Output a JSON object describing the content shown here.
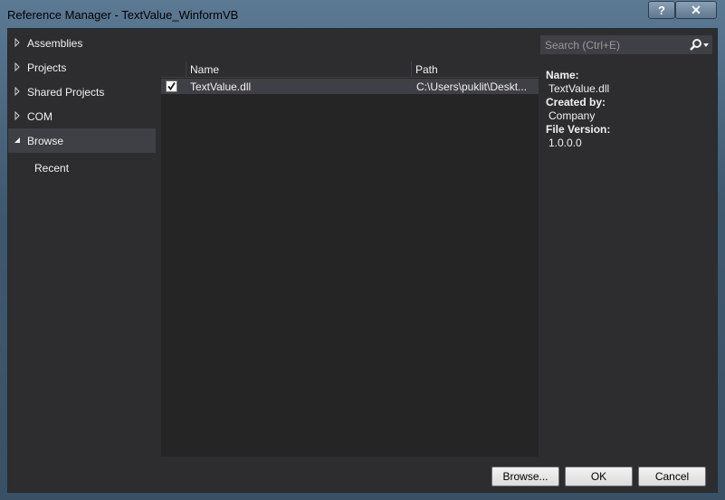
{
  "window": {
    "title": "Reference Manager - TextValue_WinformVB",
    "help_label": "?",
    "close_label": "✕"
  },
  "nav": {
    "items": [
      {
        "label": "Assemblies"
      },
      {
        "label": "Projects"
      },
      {
        "label": "Shared Projects"
      },
      {
        "label": "COM"
      },
      {
        "label": "Browse"
      }
    ],
    "sub_items": [
      {
        "label": "Recent"
      }
    ]
  },
  "list": {
    "columns": [
      "Name",
      "Path"
    ],
    "rows": [
      {
        "checked": true,
        "name": "TextValue.dll",
        "path": "C:\\Users\\puklit\\Deskt..."
      }
    ]
  },
  "search": {
    "placeholder": "Search (Ctrl+E)",
    "icon": "search-icon"
  },
  "details": {
    "name_label": "Name:",
    "name_value": "TextValue.dll",
    "created_label": "Created by:",
    "created_value": "Company",
    "version_label": "File Version:",
    "version_value": "1.0.0.0"
  },
  "buttons": {
    "browse": "Browse...",
    "ok": "OK",
    "cancel": "Cancel"
  },
  "colors": {
    "background": "#2d2d30",
    "list": "#252526",
    "selection": "#3f3f46",
    "text": "#f1f1f1"
  }
}
